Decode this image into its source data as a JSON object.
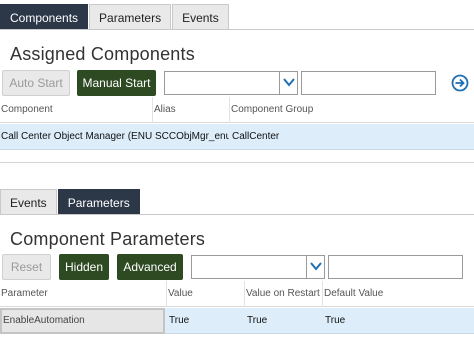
{
  "top_tabs": [
    {
      "label": "Components",
      "active": true
    },
    {
      "label": "Parameters",
      "active": false
    },
    {
      "label": "Events",
      "active": false
    }
  ],
  "assigned": {
    "title": "Assigned Components",
    "buttons": {
      "auto_start": "Auto Start",
      "manual_start": "Manual Start"
    },
    "query_select": {
      "value": ""
    },
    "query_text": {
      "value": ""
    },
    "columns": [
      "Component",
      "Alias",
      "Component Group"
    ],
    "rows": [
      {
        "component": "Call Center Object Manager (ENU)",
        "alias": "SCCObjMgr_enu",
        "group": "CallCenter"
      }
    ]
  },
  "bottom_tabs": [
    {
      "label": "Events",
      "active": false
    },
    {
      "label": "Parameters",
      "active": true
    }
  ],
  "params": {
    "title": "Component Parameters",
    "buttons": {
      "reset": "Reset",
      "hidden": "Hidden",
      "advanced": "Advanced"
    },
    "query_select": {
      "value": ""
    },
    "query_text": {
      "value": ""
    },
    "columns": [
      "Parameter",
      "Value",
      "Value on Restart",
      "Default Value"
    ],
    "rows": [
      {
        "parameter": "EnableAutomation",
        "value": "True",
        "value_on_restart": "True",
        "default_value": "True"
      }
    ]
  },
  "colors": {
    "tab_active": "#2c3748",
    "button_green": "#2e4a23",
    "row_selected": "#ddeefa",
    "icon_blue": "#1f6fb5"
  },
  "icons": {
    "dropdown": "chevron-down-icon",
    "go": "arrow-right-circle-icon"
  }
}
